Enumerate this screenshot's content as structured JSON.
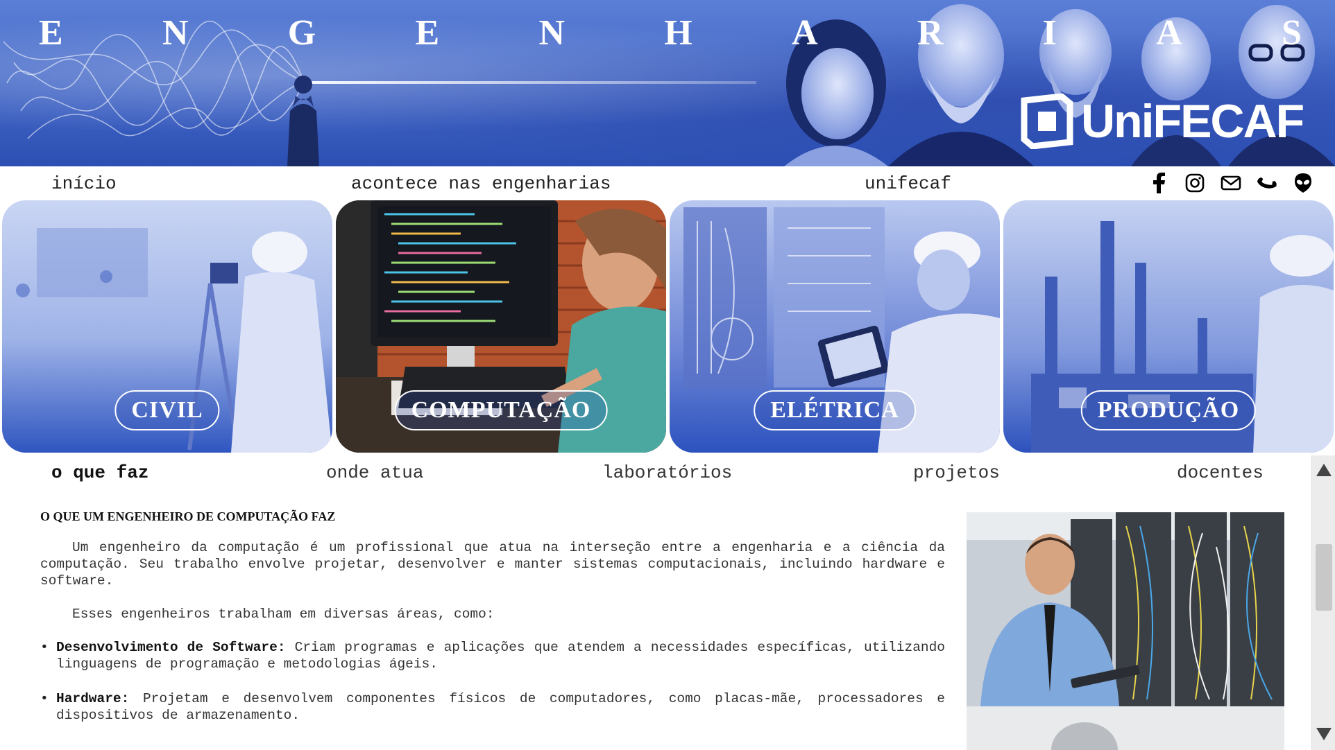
{
  "banner": {
    "title_letters": [
      "E",
      "N",
      "G",
      "E",
      "N",
      "H",
      "A",
      "R",
      "I",
      "A",
      "S"
    ],
    "logo_text": "UniFECAF"
  },
  "topnav": {
    "items": [
      {
        "label": "início"
      },
      {
        "label": "acontece nas engenharias"
      },
      {
        "label": "unifecaf"
      }
    ],
    "social_icons": [
      "facebook-icon",
      "instagram-icon",
      "email-icon",
      "phone-icon",
      "alien-icon"
    ]
  },
  "cards": [
    {
      "label": "CIVIL"
    },
    {
      "label": "COMPUTAÇÃO"
    },
    {
      "label": "ELÉTRICA"
    },
    {
      "label": "PRODUÇÃO"
    }
  ],
  "subtabs": {
    "items": [
      {
        "label": "o que faz",
        "active": true
      },
      {
        "label": "onde atua"
      },
      {
        "label": "laboratórios"
      },
      {
        "label": "projetos"
      },
      {
        "label": "docentes"
      }
    ]
  },
  "content": {
    "title": "O QUE UM ENGENHEIRO DE COMPUTAÇÃO FAZ",
    "paragraphs": [
      "Um engenheiro da computação é um profissional que atua na interseção entre a engenharia e a ciência da computação. Seu trabalho envolve projetar, desenvolver e manter sistemas computacionais, incluindo hardware e software.",
      "Esses engenheiros trabalham em diversas áreas, como:"
    ],
    "bullets": [
      {
        "term": "Desenvolvimento de Software:",
        "text": " Criam programas e aplicações que atendem a necessidades específicas, utilizando linguagens de programação e metodologias ágeis."
      },
      {
        "term": "Hardware:",
        "text": " Projetam e desenvolvem componentes físicos de computadores, como placas-mãe, processadores e dispositivos de armazenamento."
      }
    ]
  },
  "colors": {
    "brand_blue": "#3f63c4",
    "card_blue": "#2f55bf"
  }
}
